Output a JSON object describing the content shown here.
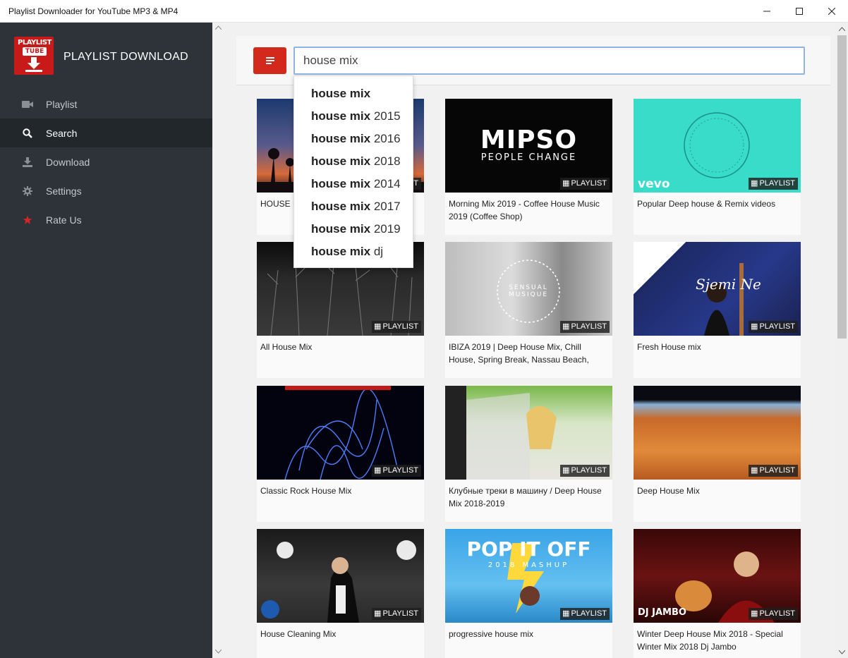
{
  "window": {
    "title": "Playlist Downloader for YouTube MP3 & MP4"
  },
  "sidebar": {
    "logo_line1": "PLAYLIST",
    "logo_line2": "TUBE",
    "brand": "PLAYLIST DOWNLOAD",
    "items": [
      {
        "label": "Playlist",
        "icon": "video-camera-icon",
        "active": false
      },
      {
        "label": "Search",
        "icon": "search-icon",
        "active": true
      },
      {
        "label": "Download",
        "icon": "download-icon",
        "active": false
      },
      {
        "label": "Settings",
        "icon": "gear-icon",
        "active": false
      },
      {
        "label": "Rate Us",
        "icon": "star-icon",
        "active": false
      }
    ]
  },
  "search": {
    "value": "house mix",
    "suggestions": [
      {
        "bold": "house mix",
        "rest": ""
      },
      {
        "bold": "house mix",
        "rest": " 2015"
      },
      {
        "bold": "house mix",
        "rest": " 2016"
      },
      {
        "bold": "house mix",
        "rest": " 2018"
      },
      {
        "bold": "house mix",
        "rest": " 2014"
      },
      {
        "bold": "house mix",
        "rest": " 2017"
      },
      {
        "bold": "house mix",
        "rest": " 2019"
      },
      {
        "bold": "house mix",
        "rest": " dj"
      }
    ]
  },
  "badge_label": "PLAYLIST",
  "results": [
    {
      "title": "HOUSE MIX",
      "badge": true
    },
    {
      "title": "Morning Mix 2019 - Coffee House Music 2019 (Coffee Shop)",
      "badge": true,
      "overlay_main": "MIPSO",
      "overlay_sub": "PEOPLE CHANGE"
    },
    {
      "title": "Popular Deep house & Remix videos",
      "badge": true,
      "overlay_main": "vevo"
    },
    {
      "title": "All House Mix",
      "badge": true
    },
    {
      "title": "IBIZA 2019 | Deep House Mix, Chill House, Spring Break, Nassau Beach,",
      "badge": true,
      "overlay_main": "SENSUAL MUSIQUE"
    },
    {
      "title": "Fresh House mix",
      "badge": true,
      "overlay_main": "Sjemi Ne"
    },
    {
      "title": "Classic Rock House Mix",
      "badge": true
    },
    {
      "title": "Клубные треки в машину / Deep House Mix 2018-2019",
      "badge": true
    },
    {
      "title": "Deep House Mix",
      "badge": true
    },
    {
      "title": "House Cleaning Mix",
      "badge": true
    },
    {
      "title": "progressive house mix",
      "badge": true,
      "overlay_main": "POP IT OFF",
      "overlay_sub": "2018 MASHUP"
    },
    {
      "title": "Winter Deep House Mix 2018 - Special Winter Mix 2018 Dj Jambo",
      "badge": true,
      "overlay_main": "DJ JAMBO"
    }
  ],
  "colors": {
    "sidebar_bg": "#2d3339",
    "sidebar_active": "#22272c",
    "accent_red": "#d3281c",
    "star_red": "#d9262a"
  }
}
